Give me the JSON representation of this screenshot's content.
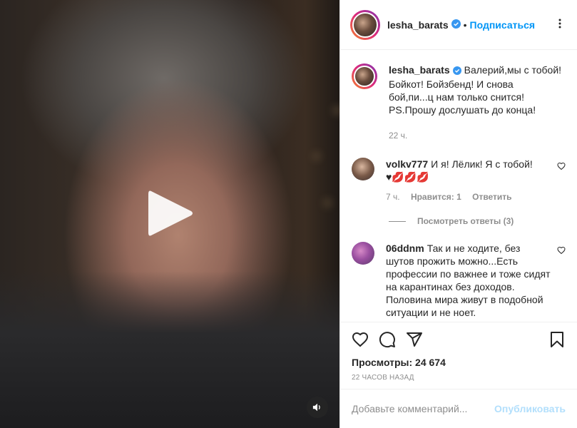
{
  "post": {
    "author": "lesha_barats",
    "follow_label": "Подписаться",
    "caption_lines": [
      "Валерий,мы с тобой!",
      "Бойкот! Бойзбенд! И снова",
      "бой,пи...ц нам только снится!",
      "PS.Прошу дослушать до конца!"
    ],
    "caption_age": "22 ч."
  },
  "comments": [
    {
      "user": "volkv777",
      "text": "И я! Лёлик! Я с тобой!",
      "emoji": "♥💋💋💋",
      "age": "7 ч.",
      "likes": "Нравится: 1",
      "reply": "Ответить",
      "view_replies": "Посмотреть ответы (3)"
    },
    {
      "user": "06ddnm",
      "text": "Так и не ходите, без шутов прожить можно...Есть профессии по важнее и тоже сидят на карантинах без доходов. Половина мира живут в подобной ситуации и не ноет."
    }
  ],
  "stats": {
    "views": "Просмотры: 24 674",
    "posted": "22 часов назад"
  },
  "composer": {
    "placeholder": "Добавьте комментарий...",
    "publish_label": "Опубликовать"
  },
  "colors": {
    "link": "#0095f6",
    "muted": "#8e8e8e",
    "verified": "#3897f0",
    "publish_disabled": "#b2dffc"
  }
}
